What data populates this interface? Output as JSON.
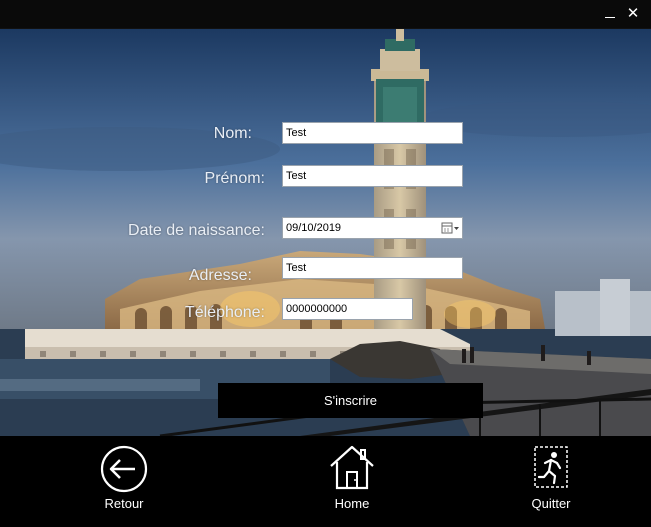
{
  "window": {
    "minimize_glyph": "—",
    "close_glyph": "✕"
  },
  "form": {
    "nom": {
      "label": "Nom:",
      "value": "Test"
    },
    "prenom": {
      "label": "Prénom:",
      "value": "Test"
    },
    "date_naissance": {
      "label": "Date de naissance:",
      "value": "09/10/2019"
    },
    "adresse": {
      "label": "Adresse:",
      "value": "Test"
    },
    "telephone": {
      "label": "Téléphone:",
      "value": "0000000000"
    },
    "submit_label": "S'inscrire"
  },
  "nav": {
    "back": {
      "label": "Retour",
      "icon": "arrow-left-circle-icon"
    },
    "home": {
      "label": "Home",
      "icon": "home-icon"
    },
    "quit": {
      "label": "Quitter",
      "icon": "running-exit-icon"
    }
  },
  "colors": {
    "footer_bg": "#000000",
    "button_bg": "#000000",
    "label_text": "#e9eef5"
  }
}
